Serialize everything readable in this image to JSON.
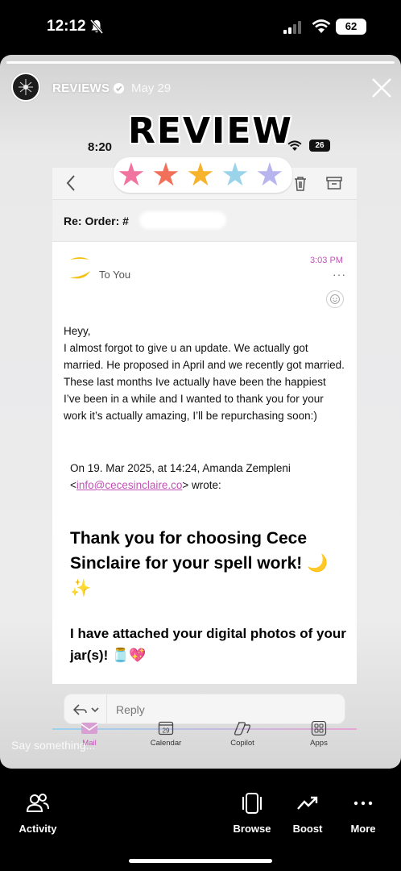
{
  "status_bar": {
    "time": "12:12",
    "battery": "62",
    "icons": [
      "bell-muted-icon",
      "signal-icon",
      "wifi-icon",
      "battery-icon"
    ]
  },
  "story": {
    "account_name": "REVIEWS",
    "date": "May 29",
    "verified": true,
    "progress": 1.0,
    "sticker_text": "REVIEW",
    "rating_stars": 5,
    "star_colors": [
      "#f1739f",
      "#f2705a",
      "#f7b32b",
      "#9bd4ea",
      "#b7b4ee"
    ],
    "reply_placeholder": "Say something..."
  },
  "email": {
    "inner_time": "8:20",
    "inner_battery": "26",
    "subject": "Re: Order: #",
    "to": "To You",
    "time": "3:03 PM",
    "more": "···",
    "body_lines": [
      "Heyy,",
      "I almost forgot to give u an update. We actually got married. He proposed in April and we recently got married. These last months Ive actually have been the happiest I’ve been in a while and I wanted to thank you for your work it’s actually amazing, I’ll be repurchasing soon:)"
    ],
    "quote_prefix": "On 19. Mar 2025, at 14:24, Amanda Zempleni <",
    "quote_link": "info@cecesinclaire.co",
    "quote_suffix": "> wrote:",
    "headline": "Thank you for choosing Cece Sinclaire for your spell work! 🌙✨",
    "subheadline": "I have attached your digital photos of your jar(s)! 🫙💖",
    "reply_label": "Reply",
    "accent_color": "#c152b6"
  },
  "inner_tabs": [
    {
      "label": "Mail",
      "icon": "mail-icon"
    },
    {
      "label": "Calendar",
      "icon": "calendar-icon",
      "day": "29"
    },
    {
      "label": "Copilot",
      "icon": "copilot-icon"
    },
    {
      "label": "Apps",
      "icon": "apps-grid-icon"
    }
  ],
  "bottom_bar": [
    {
      "label": "Activity",
      "icon": "activity-people-icon"
    },
    {
      "label": "Browse",
      "icon": "browse-icon"
    },
    {
      "label": "Boost",
      "icon": "boost-trend-icon"
    },
    {
      "label": "More",
      "icon": "more-dots-icon"
    }
  ]
}
